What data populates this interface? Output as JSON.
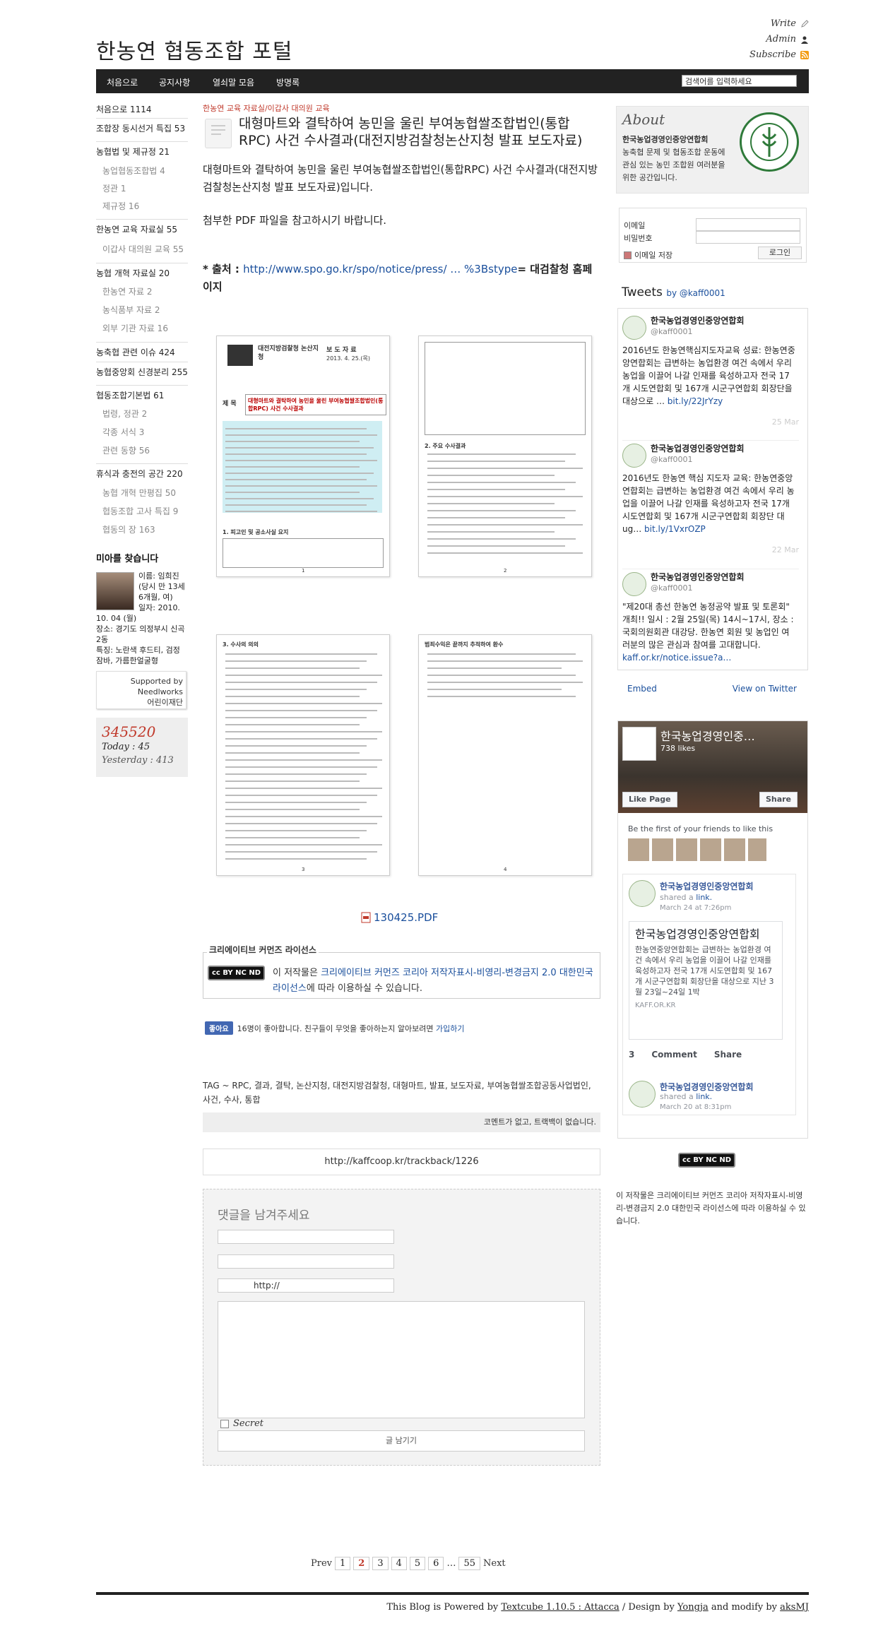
{
  "header": {
    "site_title": "한농연 협동조합 포털",
    "utility_links": [
      "Write",
      "Admin",
      "Subscribe"
    ]
  },
  "nav": {
    "items": [
      "처음으로",
      "공지사항",
      "열쇠말 모음",
      "방명록"
    ],
    "search_placeholder": "검색어를 입력하세요"
  },
  "sidebar": {
    "categories": [
      {
        "label": "처음으로 1114",
        "sub": false
      },
      {
        "label": "조합장 동시선거 특집 53",
        "sub": false
      },
      {
        "label": "농협법 및 제규정 21",
        "sub": false
      },
      {
        "label": "농업협동조합법 4",
        "sub": true
      },
      {
        "label": "정관 1",
        "sub": true
      },
      {
        "label": "제규정 16",
        "sub": true
      },
      {
        "label": "한농연 교육 자료실 55",
        "sub": false
      },
      {
        "label": "이갑사 대의원 교육 55",
        "sub": true
      },
      {
        "label": "농협 개혁 자료실 20",
        "sub": false
      },
      {
        "label": "한농연 자료 2",
        "sub": true
      },
      {
        "label": "농식품부 자료 2",
        "sub": true
      },
      {
        "label": "외부 기관 자료 16",
        "sub": true
      },
      {
        "label": "농축협 관련 이슈 424",
        "sub": false
      },
      {
        "label": "농협중앙회 신경분리 255",
        "sub": false
      },
      {
        "label": "협동조합기본법 61",
        "sub": false
      },
      {
        "label": "법령, 정관 2",
        "sub": true
      },
      {
        "label": "각종 서식 3",
        "sub": true
      },
      {
        "label": "관련 동향 56",
        "sub": true
      },
      {
        "label": "휴식과 충전의 공간 220",
        "sub": false
      },
      {
        "label": "농협 개혁 만평집 50",
        "sub": true
      },
      {
        "label": "협동조합 고사 특집 9",
        "sub": true
      },
      {
        "label": "협동의 장 163",
        "sub": true
      }
    ],
    "missing_child": {
      "title": "미아를 찾습니다",
      "lines": [
        "이름: 임희진",
        "(당시 만 13세",
        "6개월, 여)",
        "일자: 2010.",
        "10. 04 (월)",
        "장소: 경기도 의정부시 신곡2동",
        "특징: 노란색 후드티, 검정 잠바, 가름한얼굴형"
      ]
    },
    "supported_by": [
      "Supported by",
      "Needlworks",
      "어린이재단"
    ],
    "counter": {
      "total": "345520",
      "today": "Today : 45",
      "yesterday": "Yesterday : 413"
    }
  },
  "post": {
    "category_path": "한농연 교육 자료실/이갑사 대의원 교육",
    "title": "대형마트와 결탁하여 농민을 울린 부여농협쌀조합법인(통합RPC) 사건 수사결과(대전지방검찰청논산지청 발표 보도자료)",
    "intro": "대형마트와 결탁하여 농민을 울린 부여농협쌀조합법인(통합RPC) 사건 수사결과(대전지방검찰청논산지청 발표 보도자료)입니다.",
    "attachment_note": "첨부한 PDF 파일을 참고하시기 바랍니다.",
    "source_label": "* 출처 : ",
    "source_link": "http://www.spo.go.kr/spo/notice/press/ … %3Bstype",
    "source_suffix": "= 대검찰청 홈페이지",
    "scan_pages": [
      "1",
      "2",
      "3",
      "4"
    ],
    "scan_page1": {
      "header_org": "대전지방검찰청 논산지청",
      "header_kind": "보 도 자 료",
      "date": "2013. 4. 25.(목)",
      "title_label": "제 목",
      "title": "대형마트와 결탁하여 농민을 울린 부여농협쌀조합법인(통합RPC) 사건 수사결과",
      "section": "1. 피고인 및 공소사실 요지"
    },
    "scan_page2_section": "2. 주요 수사결과",
    "scan_page3_section": "3. 수사의 의의",
    "scan_page4_section": "범죄수익은 끝까지 추적하여 환수",
    "pdf_file": "130425.PDF",
    "license_title": "크리에이티브 커먼즈 라이선스",
    "license_prefix": "이 저작물은 ",
    "license_link": "크리에이티브 커먼즈 코리아 저작자표시-비영리-변경금지 2.0 대한민국 라이선스",
    "license_suffix": "에 따라 이용하실 수 있습니다.",
    "cc_badge": "cc BY NC ND",
    "like_button": "좋아요",
    "like_text": "16명이 좋아합니다. 친구들이 무엇을 좋아하는지 알아보려면 ",
    "like_join": "가입하기",
    "tags": "TAG ~ RPC, 결과, 결탁, 논산지청, 대전지방검찰청, 대형마트, 발표, 보도자료, 부여농협쌀조합공동사업법인, 사건, 수사, 통합",
    "comment_status": "코멘트가 없고,   트랙백이 없습니다.",
    "trackback_url": "http://kaffcoop.kr/trackback/1226"
  },
  "comment_form": {
    "heading": "댓글을 남겨주세요",
    "homepage_value": "http://",
    "secret_label": "Secret",
    "submit_label": "글 남기기"
  },
  "pagination": {
    "prev": "Prev",
    "pages": [
      "1",
      "2",
      "3",
      "4",
      "5",
      "6",
      "…",
      "55"
    ],
    "current": "2",
    "next": "Next"
  },
  "footer": {
    "prefix": "This Blog is Powered by ",
    "textcube": "Textcube 1.10.5 : Attacca",
    "mid": " / Design by ",
    "designer": "Yongja",
    "mid2": " and modify by ",
    "modifier": "aksMJ"
  },
  "right": {
    "about_title": "About",
    "about_org": "한국농업경영인중앙연합회",
    "about_text": "농축협 문제 및 협동조합 운동에 관심 있는 농민 조합원 여러분을 위한 공간입니다.",
    "login_id_label": "이메일",
    "login_pw_label": "비밀번호",
    "login_save_label": "이메일 저장",
    "login_button": "로그인",
    "tweets_title": "Tweets",
    "tweets_by": "by @kaff0001",
    "tweets": [
      {
        "name": "한국농업경영인중앙연합회",
        "handle": "@kaff0001",
        "text": "2016년도 한농연핵심지도자교육 성료: 한농연중앙연합회는 급변하는 농업환경 여건 속에서 우리 농업을 이끌어 나갈 인재를 육성하고자 전국 17개 시도연합회 및 167개 시군구연합회 회장단을 대상으로 … ",
        "link": "bit.ly/22JrYzy",
        "date": "25 Mar"
      },
      {
        "name": "한국농업경영인중앙연합회",
        "handle": "@kaff0001",
        "text": "2016년도 한농연 핵심 지도자 교육: 한농연중앙연합회는 급변하는 농업환경 여건 속에서 우리 농업을 이끌어 나갈 인재를 육성하고자 전국 17개 시도연합회 및 167개 시군구연합회 회장단 대ug… ",
        "link": "bit.ly/1VxrOZP",
        "date": "22 Mar"
      },
      {
        "name": "한국농업경영인중앙연합회",
        "handle": "@kaff0001",
        "text": "\"제20대 총선 한농연 농정공약 발표 및 토론회\" 개최!! 일시 : 2월 25일(목) 14시~17시, 장소 : 국회의원회관 대강당. 한농연 회원 및 농업인 여러분의 많은 관심과 참여를 고대합니다. ",
        "link": "kaff.or.kr/notice.issue?a…",
        "date": ""
      }
    ],
    "tw_embed": "Embed",
    "tw_view": "View on Twitter",
    "fb": {
      "page_name": "한국농업경영인중…",
      "likes": "738 likes",
      "like_page": "Like Page",
      "share": "Share",
      "friends_text": "Be the first of your friends to like this",
      "post_name": "한국농업경영인중앙연합회",
      "shared": "shared a ",
      "shared_link": "link.",
      "post_date": "March 24 at 7:26pm",
      "card_title": "한국농업경영인중앙연합회",
      "card_text": "한농연중앙연합회는 급변하는 농업환경 여건 속에서 우리 농업을 이끌어 나갈 인재를 육성하고자 전국 17개 시도연합회 및 167개 시군구연합회 회장단을 대상으로 지난 3월 23일~24일 1박",
      "card_domain": "KAFF.OR.KR",
      "reactions": "3",
      "comment": "Comment",
      "share2": "Share",
      "post2_name": "한국농업경영인중앙연합회",
      "post2_date": "March 20 at 8:31pm"
    },
    "cc_text": "이 저작물은 크리에이티브 커먼즈 코리아 저작자표시-비영리-변경금지 2.0 대한민국 라이선스에 따라 이용하실 수 있습니다."
  }
}
